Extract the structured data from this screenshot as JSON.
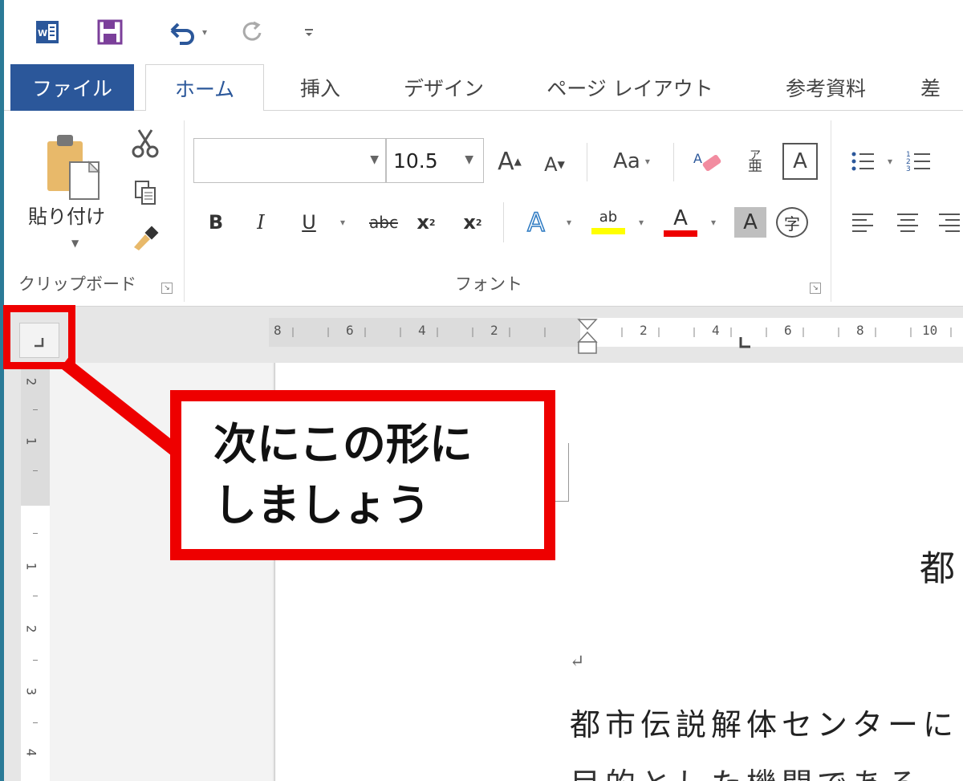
{
  "quick_access": {
    "word_icon": "word-logo-icon",
    "save_icon": "save-icon",
    "undo_icon": "undo-icon",
    "redo_icon": "redo-icon",
    "more_icon": "customize-qat-icon"
  },
  "tabs": [
    {
      "label": "ファイル"
    },
    {
      "label": "ホーム"
    },
    {
      "label": "挿入"
    },
    {
      "label": "デザイン"
    },
    {
      "label": "ページ レイアウト"
    },
    {
      "label": "参考資料"
    },
    {
      "label": "差"
    }
  ],
  "ribbon": {
    "clipboard": {
      "paste_label": "貼り付け",
      "group_label": "クリップボード"
    },
    "font": {
      "font_name": "",
      "font_size": "10.5",
      "group_label": "フォント",
      "grow_label": "A",
      "shrink_label": "A",
      "case_label": "Aa",
      "bold": "B",
      "italic": "I",
      "underline": "U",
      "strike": "abc",
      "subscript": "x",
      "superscript": "x",
      "effects": "A",
      "highlight": "ab",
      "font_color": "A",
      "shading": "A",
      "enclose": "字",
      "ruby": "亜",
      "border_char": "A"
    },
    "colors": {
      "highlight_color": "#ffff00",
      "font_color_bar": "#ff0000",
      "brand": "#2b579a"
    }
  },
  "ruler": {
    "h_numbers": [
      "8",
      "6",
      "4",
      "2",
      "2",
      "4",
      "6",
      "8",
      "10"
    ],
    "v_numbers": [
      "2",
      "1",
      "1",
      "2",
      "3",
      "4"
    ]
  },
  "document": {
    "title_char": "都",
    "return_mark": "↵",
    "line1": "都市伝説解体センターに",
    "line2": "目的とした機関である。"
  },
  "annotation": {
    "line1": "次にこの形に",
    "line2": "しましょう"
  }
}
